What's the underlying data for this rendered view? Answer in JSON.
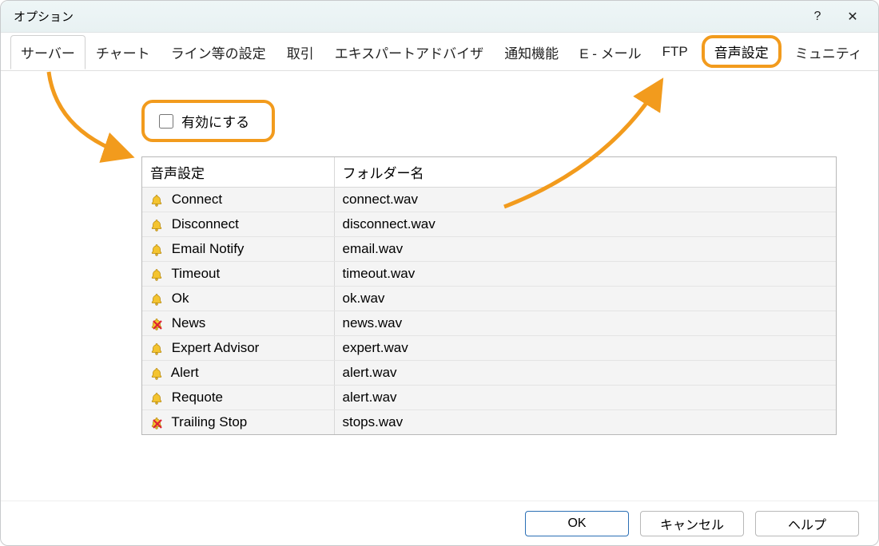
{
  "window": {
    "title": "オプション",
    "help_symbol": "?",
    "close_symbol": "✕"
  },
  "tabs": {
    "items": [
      "サーバー",
      "チャート",
      "ライン等の設定",
      "取引",
      "エキスパートアドバイザ",
      "通知機能",
      "E - メール",
      "FTP"
    ],
    "highlighted": "音声設定",
    "trailing": "ミュニティ"
  },
  "enable": {
    "label": "有効にする",
    "checked": false
  },
  "table": {
    "headers": {
      "event": "音声設定",
      "folder": "フォルダー名"
    },
    "rows": [
      {
        "event": "Connect",
        "file": "connect.wav",
        "disabled": false
      },
      {
        "event": "Disconnect",
        "file": "disconnect.wav",
        "disabled": false
      },
      {
        "event": "Email Notify",
        "file": "email.wav",
        "disabled": false
      },
      {
        "event": "Timeout",
        "file": "timeout.wav",
        "disabled": false
      },
      {
        "event": "Ok",
        "file": "ok.wav",
        "disabled": false
      },
      {
        "event": "News",
        "file": "news.wav",
        "disabled": true
      },
      {
        "event": "Expert Advisor",
        "file": "expert.wav",
        "disabled": false
      },
      {
        "event": "Alert",
        "file": "alert.wav",
        "disabled": false
      },
      {
        "event": "Requote",
        "file": "alert.wav",
        "disabled": false
      },
      {
        "event": "Trailing Stop",
        "file": "stops.wav",
        "disabled": true
      }
    ]
  },
  "buttons": {
    "ok": "OK",
    "cancel": "キャンセル",
    "help": "ヘルプ"
  },
  "colors": {
    "highlight": "#f29b1d"
  }
}
